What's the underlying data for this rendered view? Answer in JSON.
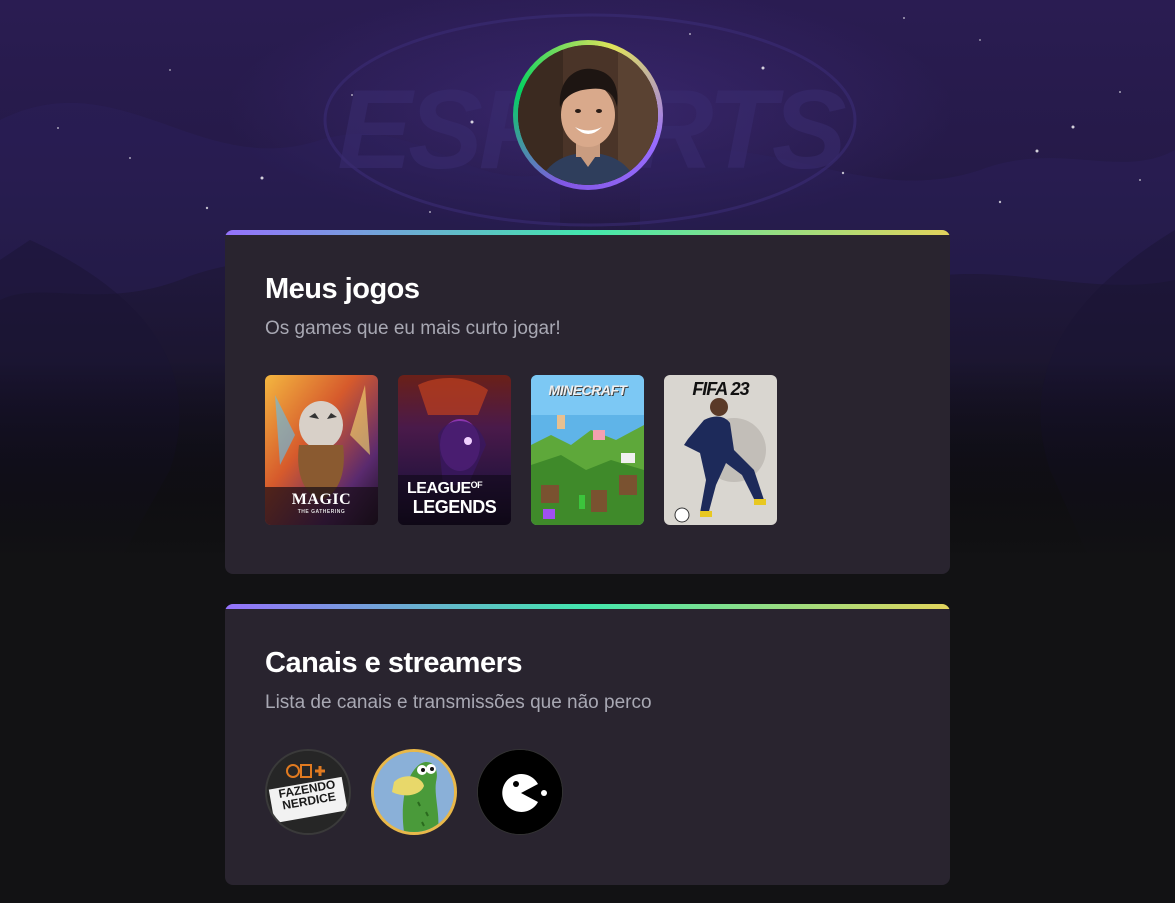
{
  "profile": {
    "avatar_icon": "profile-photo"
  },
  "games_section": {
    "title": "Meus jogos",
    "subtitle": "Os games que eu mais curto jogar!",
    "games": [
      {
        "logo_line1": "MAGIC",
        "logo_line2": "THE GATHERING",
        "icon": "magic-cover"
      },
      {
        "logo_line1": "LEAGUE",
        "logo_of": "OF",
        "logo_line2": "LEGENDS",
        "icon": "league-of-legends-cover"
      },
      {
        "logo_line1": "MINECRAFT",
        "icon": "minecraft-cover"
      },
      {
        "logo_line1": "FIFA 23",
        "icon": "fifa23-cover"
      }
    ]
  },
  "streams_section": {
    "title": "Canais e streamers",
    "subtitle": "Lista de canais e transmissões que não perco",
    "streamers": [
      {
        "line1": "FAZENDO",
        "line2": "NERDICE",
        "icon": "fazendo-nerdice-avatar"
      },
      {
        "icon": "green-monster-avatar"
      },
      {
        "icon": "pacman-avatar"
      }
    ]
  },
  "colors": {
    "background": "#121214",
    "card": "#29242f",
    "gradient": [
      "#9572fc",
      "#43e7ad",
      "#e2d45c"
    ],
    "title": "#ffffff",
    "subtitle": "#a8a8b3"
  }
}
